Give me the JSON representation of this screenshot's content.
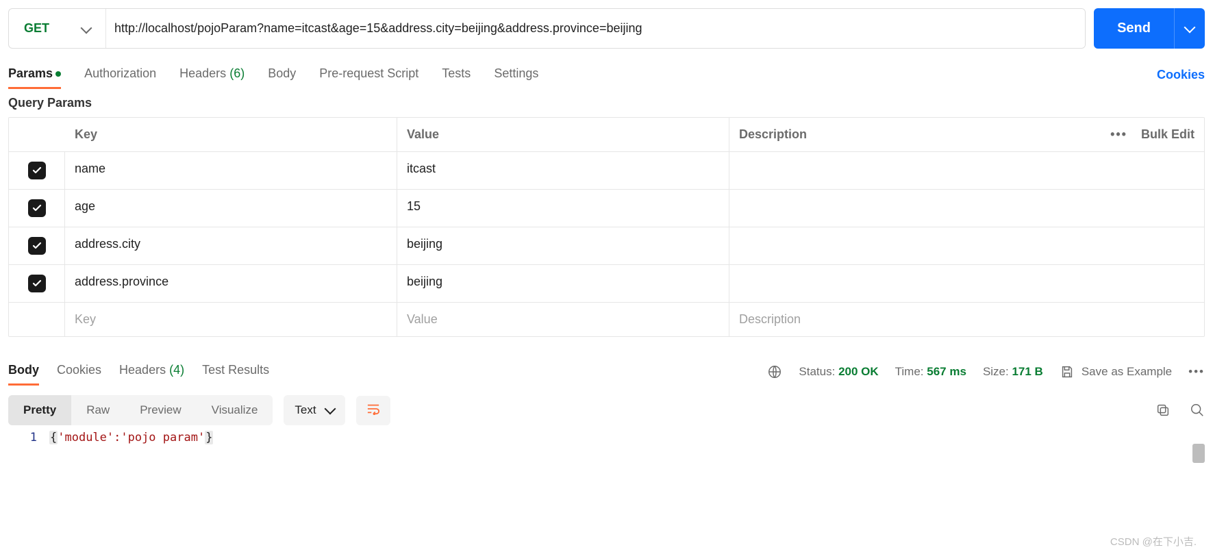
{
  "request": {
    "method": "GET",
    "url": "http://localhost/pojoParam?name=itcast&age=15&address.city=beijing&address.province=beijing",
    "send_label": "Send"
  },
  "tabs": {
    "params": "Params",
    "authorization": "Authorization",
    "headers": "Headers",
    "headers_count": "(6)",
    "body": "Body",
    "prerequest": "Pre-request Script",
    "tests": "Tests",
    "settings": "Settings",
    "cookies_link": "Cookies"
  },
  "query_params": {
    "title": "Query Params",
    "columns": {
      "key": "Key",
      "value": "Value",
      "description": "Description"
    },
    "bulk_edit": "Bulk Edit",
    "rows": [
      {
        "key": "name",
        "value": "itcast",
        "description": ""
      },
      {
        "key": "age",
        "value": "15",
        "description": ""
      },
      {
        "key": "address.city",
        "value": "beijing",
        "description": ""
      },
      {
        "key": "address.province",
        "value": "beijing",
        "description": ""
      }
    ],
    "placeholders": {
      "key": "Key",
      "value": "Value",
      "description": "Description"
    }
  },
  "response_tabs": {
    "body": "Body",
    "cookies": "Cookies",
    "headers": "Headers",
    "headers_count": "(4)",
    "tests": "Test Results"
  },
  "response_meta": {
    "status_label": "Status:",
    "status_value": "200 OK",
    "time_label": "Time:",
    "time_value": "567 ms",
    "size_label": "Size:",
    "size_value": "171 B",
    "save_example": "Save as Example"
  },
  "body_toolbar": {
    "pretty": "Pretty",
    "raw": "Raw",
    "preview": "Preview",
    "visualize": "Visualize",
    "lang": "Text"
  },
  "response_body": {
    "line_number": "1",
    "brace_open": "{",
    "content": "'module':'pojo param'",
    "brace_close": "}"
  },
  "watermark": "CSDN @在下小吉."
}
